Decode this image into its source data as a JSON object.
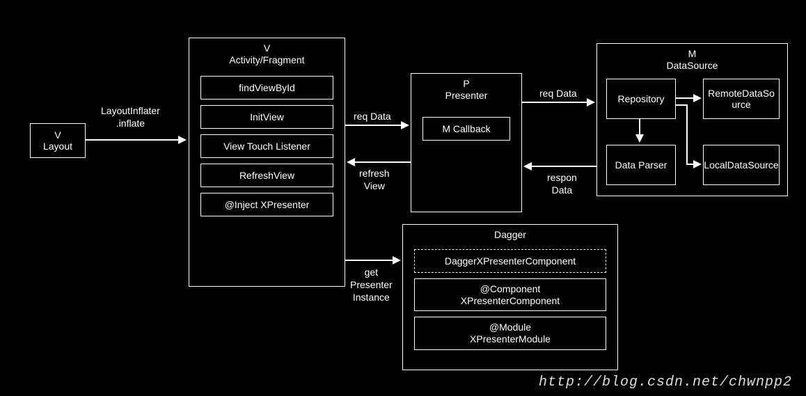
{
  "layout": {
    "title1": "V",
    "title2": "Layout"
  },
  "view": {
    "title1": "V",
    "title2": "Activity/Fragment",
    "items": [
      "findViewById",
      "InitView",
      "View Touch Listener",
      "RefreshView",
      "@Inject XPresenter"
    ]
  },
  "presenter": {
    "title1": "P",
    "title2": "Presenter",
    "callback": "M Callback"
  },
  "model": {
    "title1": "M",
    "title2": "DataSource",
    "repository": "Repository",
    "parser": "Data Parser",
    "remote": "RemoteDataSource",
    "local": "LocalDataSource"
  },
  "dagger": {
    "title": "Dagger",
    "items": [
      "DaggerXPresenterComponent",
      "@Component XPresenterComponent",
      "@Module XPresenterModule"
    ]
  },
  "edges": {
    "inflate1": "LayoutInflater",
    "inflate2": ".inflate",
    "reqData": "req Data",
    "refresh1": "refresh",
    "refresh2": "View",
    "reqData2": "req Data",
    "respon1": "respon",
    "respon2": "Data",
    "get1": "get",
    "get2": "Presenter",
    "get3": "Instance"
  },
  "watermark": "http://blog.csdn.net/chwnpp2"
}
